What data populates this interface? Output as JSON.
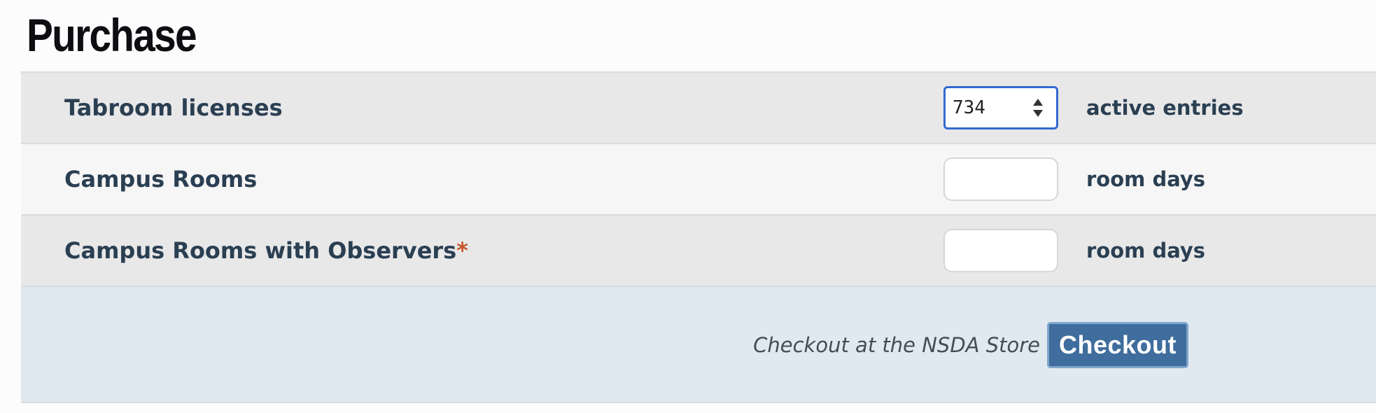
{
  "page": {
    "title": "Purchase"
  },
  "rows": [
    {
      "label": "Tabroom licenses",
      "required": false,
      "value": "734",
      "unit": "active entries"
    },
    {
      "label": "Campus Rooms",
      "required": false,
      "value": "",
      "unit": "room days"
    },
    {
      "label": "Campus Rooms with Observers",
      "required": true,
      "required_marker": "*",
      "value": "",
      "unit": "room days"
    }
  ],
  "footer": {
    "text": "Checkout at the NSDA Store",
    "button_label": "Checkout"
  },
  "colors": {
    "label_text": "#2b3f52",
    "required_marker": "#c9532a",
    "button_bg": "#3f6d9d",
    "footer_bg": "#e1e9f0",
    "focus_border": "#3469d0"
  },
  "icons": {
    "spinner": "up-down-spinner-icon"
  }
}
